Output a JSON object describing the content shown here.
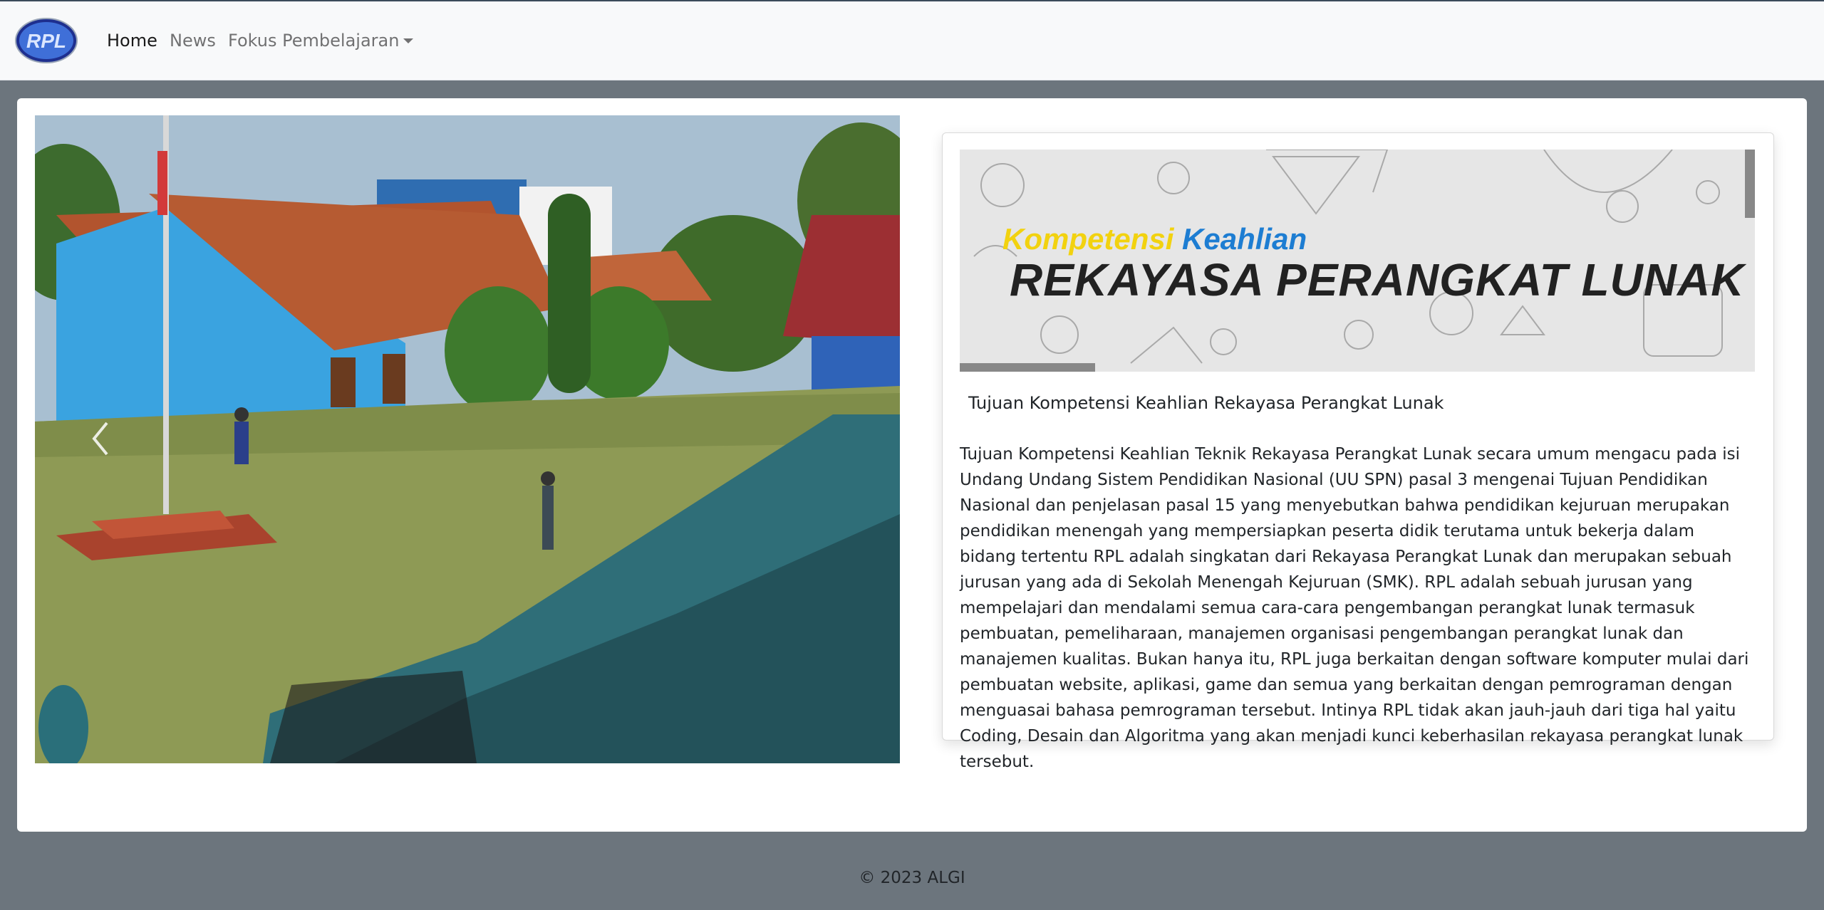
{
  "navbar": {
    "logo_text": "RPL",
    "links": [
      {
        "label": "Home",
        "active": true
      },
      {
        "label": "News",
        "active": false
      },
      {
        "label": "Fokus Pembelajaran",
        "active": false,
        "dropdown": true
      }
    ]
  },
  "carousel": {
    "prev_icon": "chevron-left-icon"
  },
  "info_card": {
    "banner": {
      "line1_part1": "Kompetensi",
      "line1_part2": "Keahlian",
      "line2": "REKAYASA PERANGKAT LUNAK"
    },
    "title": "Tujuan Kompetensi Keahlian Rekayasa Perangkat Lunak",
    "text": "Tujuan Kompetensi Keahlian Teknik Rekayasa Perangkat Lunak secara umum mengacu pada isi Undang Undang Sistem Pendidikan Nasional (UU SPN) pasal 3 mengenai Tujuan Pendidikan Nasional dan penjelasan pasal 15 yang menyebutkan bahwa pendidikan kejuruan merupakan pendidikan menengah yang mempersiapkan peserta didik terutama untuk bekerja dalam bidang tertentu RPL adalah singkatan dari Rekayasa Perangkat Lunak dan merupakan sebuah jurusan yang ada di Sekolah Menengah Kejuruan (SMK). RPL adalah sebuah jurusan yang mempelajari dan mendalami semua cara-cara pengembangan perangkat lunak termasuk pembuatan, pemeliharaan, manajemen organisasi pengembangan perangkat lunak dan manajemen kualitas. Bukan hanya itu, RPL juga berkaitan dengan software komputer mulai dari pembuatan website, aplikasi, game dan semua yang berkaitan dengan pemrograman dengan menguasai bahasa pemrograman tersebut. Intinya RPL tidak akan jauh-jauh dari tiga hal yaitu Coding, Desain dan Algoritma yang akan menjadi kunci keberhasilan rekayasa perangkat lunak tersebut."
  },
  "footer": {
    "text": "© 2023 ALGI"
  },
  "colors": {
    "navbar_bg": "#f8f9fa",
    "page_bg": "#6c757d",
    "card_bg": "#ffffff",
    "banner_yellow": "#f2d20f",
    "banner_blue": "#1d7dd2"
  }
}
